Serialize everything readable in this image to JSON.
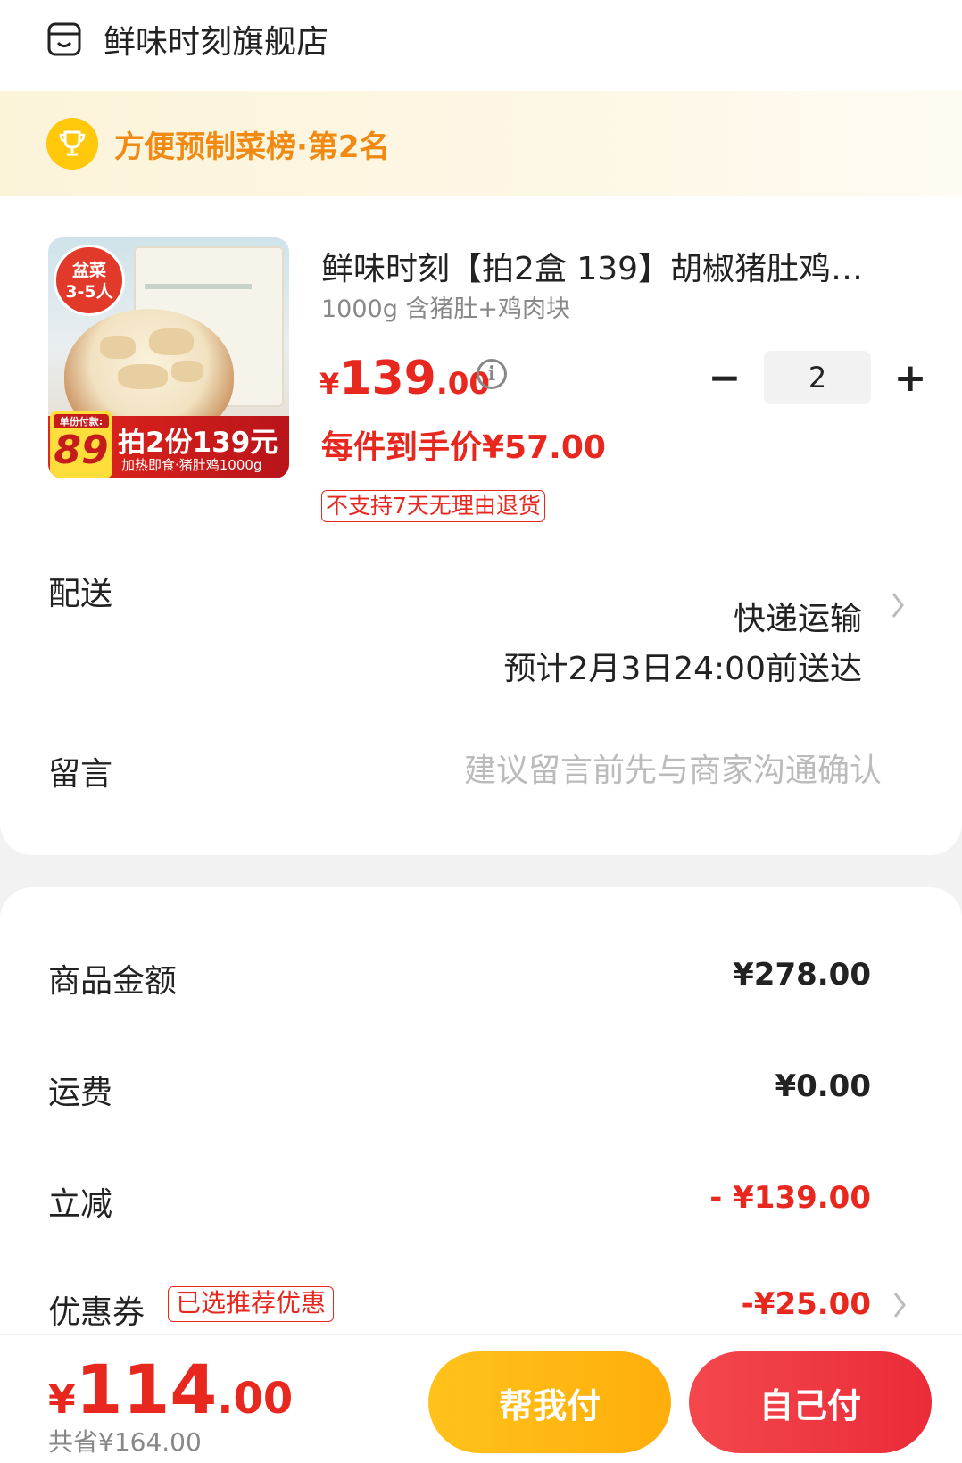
{
  "store": {
    "icon": "store-icon",
    "name": "鲜味时刻旗舰店"
  },
  "rank": {
    "icon": "trophy-icon",
    "text": "方便预制菜榜·第2名"
  },
  "product": {
    "image": {
      "badge": "盆菜\n3-5人",
      "pay_label": "单份付款:",
      "pay_value": "89",
      "promo_main": "拍2份139元",
      "promo_sub": "加热即食·猪肚鸡1000g"
    },
    "title": "鲜味时刻【拍2盒 139】胡椒猪肚鸡…",
    "spec": "1000g 含猪肚+鸡肉块",
    "price": {
      "currency": "¥",
      "integer": "139",
      "decimal": ".00"
    },
    "info_icon": "info-icon",
    "quantity": {
      "minus": "−",
      "value": "2",
      "plus": "+"
    },
    "unit_price": "每件到手价¥57.00",
    "return_policy": "不支持7天无理由退货"
  },
  "delivery": {
    "label": "配送",
    "method": "快递运输",
    "eta": "预计2月3日24:00前送达",
    "chevron": "chevron-right-icon"
  },
  "message": {
    "label": "留言",
    "placeholder": "建议留言前先与商家沟通确认"
  },
  "summary": {
    "goods_label": "商品金额",
    "goods_value": "¥278.00",
    "shipping_label": "运费",
    "shipping_value": "¥0.00",
    "discount_label": "立减",
    "discount_value": "- ¥139.00",
    "coupon_label": "优惠券",
    "coupon_tag": "已选推荐优惠",
    "coupon_value": "-¥25.00"
  },
  "footer": {
    "total": {
      "currency": "¥",
      "integer": "114",
      "decimal": ".00"
    },
    "saved": "共省¥164.00",
    "help_pay": "帮我付",
    "self_pay": "自己付"
  },
  "colors": {
    "accent": "#e8271f",
    "rank": "#f08a12",
    "help": "#ffb90f",
    "self": "#ee3540"
  }
}
